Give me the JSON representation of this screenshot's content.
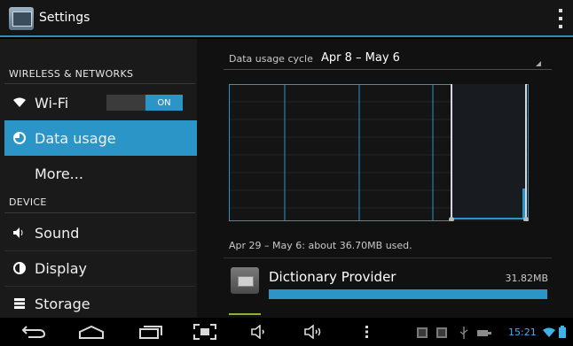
{
  "actionbar": {
    "title": "Settings"
  },
  "sidebar": {
    "categories": [
      "WIRELESS & NETWORKS",
      "DEVICE"
    ],
    "items": [
      {
        "label": "Wi-Fi",
        "icon": "wifi-icon",
        "toggle": "ON"
      },
      {
        "label": "Data usage",
        "icon": "data-usage-icon",
        "selected": true
      },
      {
        "label": "More..."
      },
      {
        "label": "Sound",
        "icon": "speaker-icon"
      },
      {
        "label": "Display",
        "icon": "display-icon"
      },
      {
        "label": "Storage",
        "icon": "storage-icon"
      }
    ]
  },
  "detail": {
    "cycle_label": "Data usage cycle",
    "cycle_value": "Apr 8 – May 6",
    "summary": "Apr 29 – May 6: about 36.70MB used.",
    "app": {
      "name": "Dictionary Provider",
      "size": "31.82MB",
      "usage_fraction": 1.0
    }
  },
  "statusbar": {
    "time": "15:21"
  },
  "colors": {
    "accent": "#2c95c7",
    "time": "#3fb3e8"
  }
}
